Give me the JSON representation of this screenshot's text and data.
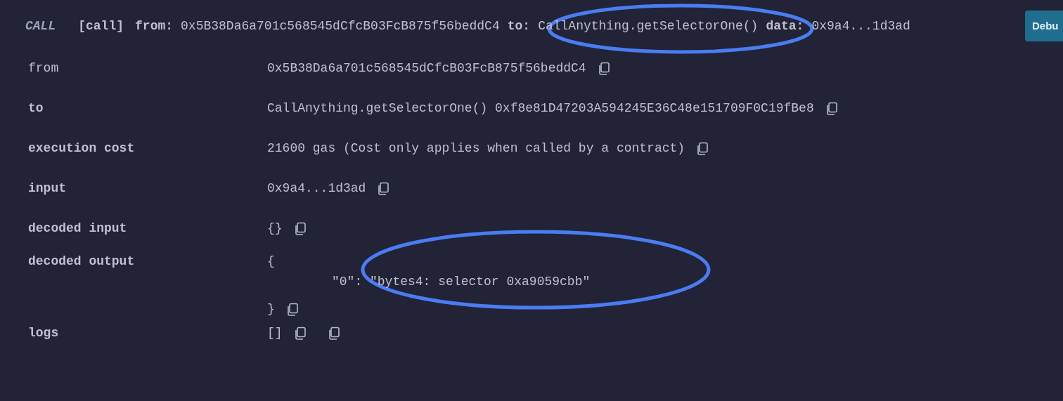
{
  "header": {
    "call_kind": "CALL",
    "call_type": "[call]",
    "from_label": "from:",
    "from": "0x5B38Da6a701c568545dCfcB03FcB875f56beddC4",
    "to_label": "to:",
    "to": "CallAnything.getSelectorOne()",
    "data_label": "data:",
    "data": "0x9a4...1d3ad",
    "debug_button": "Debu"
  },
  "rows": [
    {
      "label": "from",
      "bold": false,
      "kind": "text",
      "value": "0x5B38Da6a701c568545dCfcB03FcB875f56beddC4",
      "actions": [
        {
          "kind": "copy"
        }
      ]
    },
    {
      "label": "to",
      "bold": true,
      "kind": "text",
      "value": "CallAnything.getSelectorOne() 0xf8e81D47203A594245E36C48e151709F0C19fBe8",
      "actions": [
        {
          "kind": "copy"
        }
      ]
    },
    {
      "label": "execution cost",
      "bold": true,
      "kind": "text",
      "value": "21600 gas (Cost only applies when called by a contract)",
      "actions": [
        {
          "kind": "copy"
        }
      ]
    },
    {
      "label": "input",
      "bold": true,
      "kind": "text",
      "value": "0x9a4...1d3ad",
      "actions": [
        {
          "kind": "copy"
        }
      ]
    },
    {
      "label": "decoded input",
      "bold": true,
      "kind": "text",
      "value": "{}",
      "actions": [
        {
          "kind": "copy"
        }
      ]
    },
    {
      "label": "decoded output",
      "bold": true,
      "kind": "object",
      "open": "{",
      "entries": [
        "\"0\": \"bytes4: selector 0xa9059cbb\""
      ],
      "close": "}",
      "actions": [
        {
          "kind": "copy"
        }
      ]
    },
    {
      "label": "logs",
      "bold": true,
      "kind": "text",
      "value": "[]",
      "actions": [
        {
          "kind": "copy"
        },
        {
          "kind": "copy"
        }
      ]
    }
  ]
}
